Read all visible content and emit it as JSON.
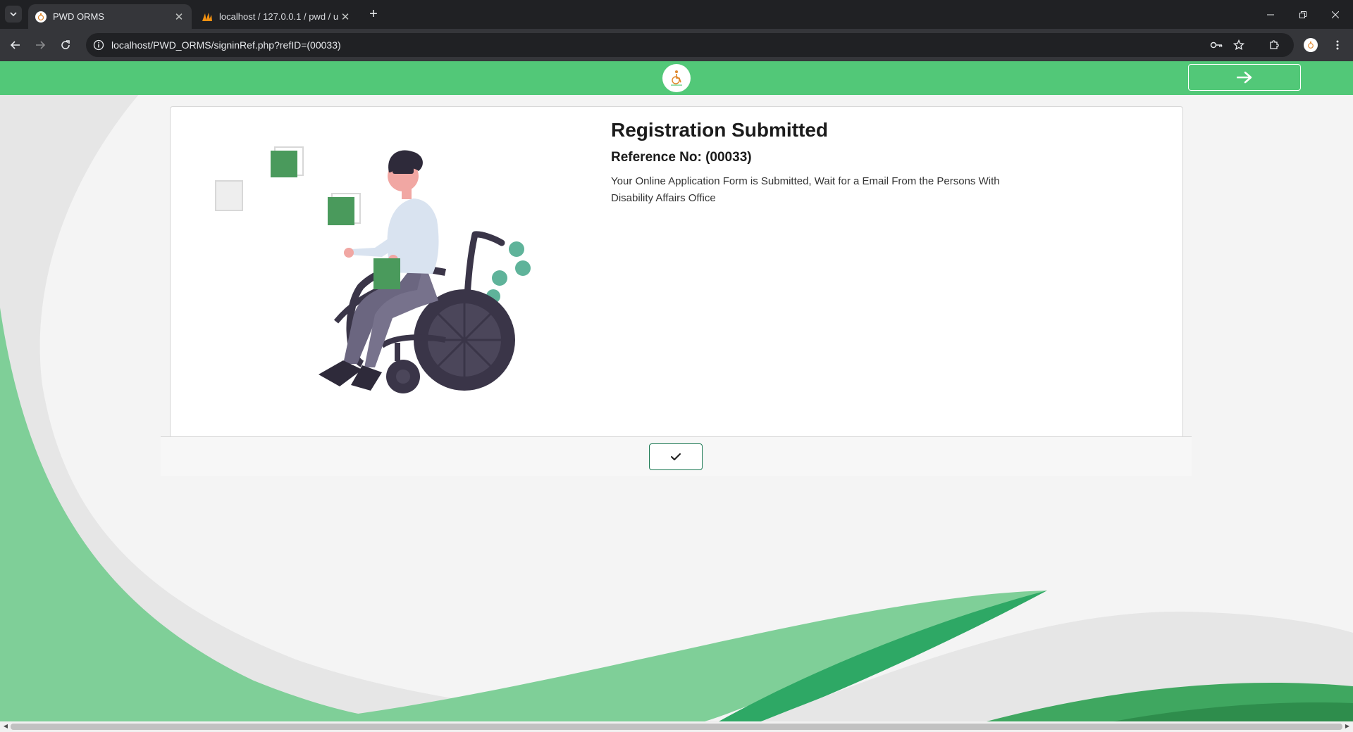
{
  "browser": {
    "tabs": [
      {
        "title": "PWD ORMS",
        "active": true,
        "favicon": "pwd-logo-icon"
      },
      {
        "title": "localhost / 127.0.0.1 / pwd / us",
        "active": false,
        "favicon": "phpmyadmin-icon"
      }
    ],
    "url": "localhost/PWD_ORMS/signinRef.php?refID=(00033)"
  },
  "page": {
    "header": {
      "logo": "pwd-logo-icon",
      "nav_button_icon": "arrow-right-icon"
    },
    "card": {
      "heading": "Registration Submitted",
      "reference": "Reference No: (00033)",
      "message": "Your Online Application Form is Submitted, Wait for a Email From the Persons With Disability Affairs Office",
      "confirm_icon": "checkmark-icon"
    }
  },
  "colors": {
    "brand_green": "#52c878",
    "dark_green": "#1e7a55",
    "illustration_green": "#4a9a5c",
    "teal": "#5fb39a"
  }
}
